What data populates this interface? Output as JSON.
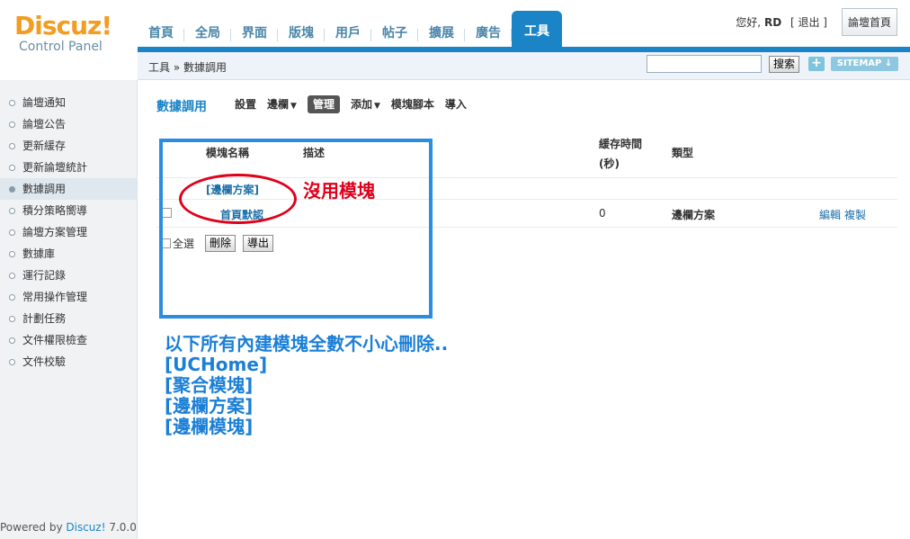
{
  "logo": {
    "name": "Discuz!",
    "subtitle": "Control Panel"
  },
  "nav": {
    "tabs": [
      "首頁",
      "全局",
      "界面",
      "版塊",
      "用戶",
      "帖子",
      "擴展",
      "廣告",
      "工具"
    ],
    "active_index": 8
  },
  "user": {
    "greeting": "您好,",
    "name": "RD",
    "logout": "[ 退出 ]",
    "forum_home": "論壇首頁"
  },
  "subheader": {
    "breadcrumb": "工具 » 數據調用",
    "search_button": "搜索",
    "plus_label": "+",
    "sitemap_label": "SITEMAP ↓"
  },
  "sidebar": {
    "items": [
      "論壇通知",
      "論壇公告",
      "更新緩存",
      "更新論壇統計",
      "數據調用",
      "積分策略嚮導",
      "論壇方案管理",
      "數據庫",
      "運行記錄",
      "常用操作管理",
      "計劃任務",
      "文件權限檢查",
      "文件校驗"
    ],
    "active_index": 4,
    "powered_prefix": "Powered by ",
    "powered_brand": "Discuz!",
    "powered_version": " 7.0.0"
  },
  "main": {
    "title": "數據調用",
    "menu": [
      "設置",
      "邊欄",
      "管理",
      "添加",
      "模塊腳本",
      "導入"
    ],
    "menu_current": 2,
    "table": {
      "headers": {
        "name": "模塊名稱",
        "desc": "描述",
        "cache_line1": "緩存時間",
        "cache_line2": "(秒)",
        "type": "類型"
      },
      "group_label": "[邊欄方案]",
      "rows": [
        {
          "name": "首頁默認",
          "desc": "",
          "cache": "0",
          "type": "邊欄方案",
          "edit": "編輯",
          "copy": "複製"
        }
      ]
    },
    "select_all": "全選",
    "delete_button": "刪除",
    "export_button": "導出"
  },
  "annotations": {
    "red_text": "沒用模塊",
    "note_lines": [
      "以下所有內建模塊全數不小心刪除..",
      "[UCHome]",
      "[聚合模塊]",
      "[邊欄方案]",
      "[邊欄模塊]"
    ]
  },
  "colors": {
    "accent": "#1b84c6",
    "logo_orange": "#f29c21",
    "annotation_red": "#e0001a",
    "annotation_blue": "#2a8ee0"
  }
}
